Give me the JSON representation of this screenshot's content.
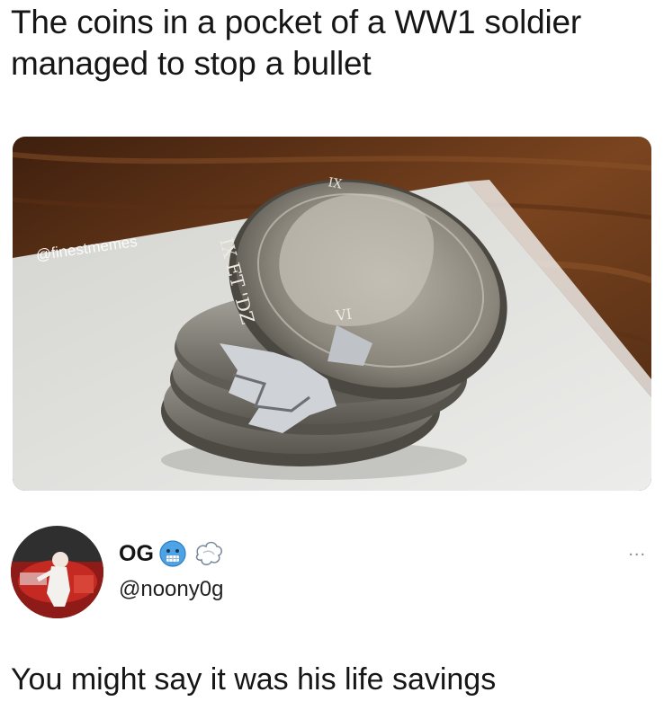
{
  "caption": {
    "line1": "The coins in a pocket of a WW1 soldier",
    "line2": "managed to stop a bullet"
  },
  "photo": {
    "watermark": "@finestmemes",
    "coin_inscription_top": "IX",
    "coin_inscription_side": "IX ET 'DZ",
    "coin_inscription_mid": "VI"
  },
  "tweet": {
    "display_name": "OG",
    "emojis": [
      "cold-face-emoji",
      "dashing-away-emoji"
    ],
    "handle": "@noony0g",
    "more_label": "...",
    "text": "You might say it was his life savings"
  },
  "colors": {
    "text": "#161616",
    "wood": "#6b3a1c",
    "paper": "#dcdcd8",
    "coin": "#8d8a82"
  }
}
